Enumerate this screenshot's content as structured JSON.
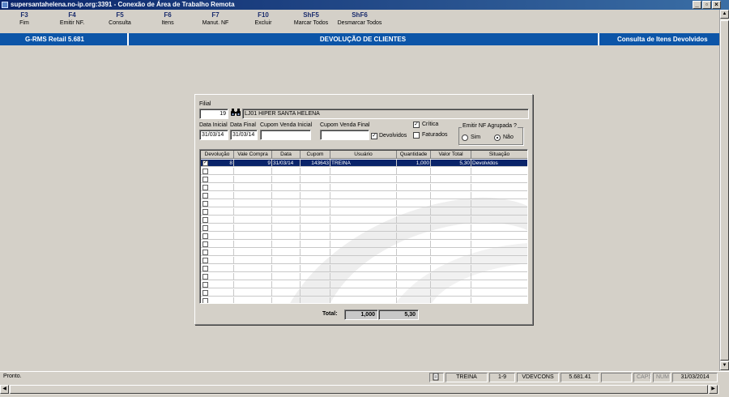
{
  "window": {
    "title": "supersantahelena.no-ip.org:3391 - Conexão de Área de Trabalho Remota",
    "min": "_",
    "restore": "▫",
    "close": "×"
  },
  "toolbar": [
    {
      "key": "F3",
      "label": "Fim"
    },
    {
      "key": "F4",
      "label": "Emitir NF."
    },
    {
      "key": "F5",
      "label": "Consulta"
    },
    {
      "key": "F6",
      "label": "Itens"
    },
    {
      "key": "F7",
      "label": "Manut. NF"
    },
    {
      "key": "F10",
      "label": "Excluir"
    },
    {
      "key": "ShF5",
      "label": "Marcar Todos"
    },
    {
      "key": "ShF6",
      "label": "Desmarcar Todos"
    }
  ],
  "header": {
    "app": "G-RMS Retail 5.681",
    "title": "DEVOLUÇÃO DE CLIENTES",
    "subtitle": "Consulta de Itens Devolvidos"
  },
  "form": {
    "filial_label": "Filial",
    "filial_code": "19",
    "filial_name": "LJ01 HIPER SANTA HELENA",
    "data_inicial_label": "Data Inicial",
    "data_inicial": "31/03/14",
    "data_final_label": "Data Final",
    "data_final": "31/03/14",
    "cupom_inicial_label": "Cupom Venda Inicial",
    "cupom_inicial": "",
    "cupom_final_label": "Cupom Venda Final",
    "cupom_final": "",
    "devolvidos_label": "Devolvidos",
    "devolvidos_checked": true,
    "critica_label": "Crítica",
    "critica_checked": true,
    "faturados_label": "Faturados",
    "faturados_checked": false,
    "agrupada_label": "Emitir NF Agrupada ?",
    "sim_label": "Sim",
    "nao_label": "Não",
    "agrupada_value": "Não",
    "check_mark": "✓"
  },
  "grid": {
    "columns": [
      "Devolução",
      "Vale Compra",
      "Data",
      "Cupom",
      "Usuário",
      "Quantidade",
      "Valor Total",
      "Situação"
    ],
    "rows": [
      {
        "checked": true,
        "devolucao": "8",
        "vale": "9",
        "data": "31/03/14",
        "cupom": "143643",
        "usuario": "TREINA",
        "quantidade": "1,000",
        "valor": "5,30",
        "situacao": "Devolvidos"
      }
    ],
    "empty_rows": 17
  },
  "totals": {
    "label": "Total:",
    "quantidade": "1,000",
    "valor": "5,30"
  },
  "statusbar": {
    "message": "Pronto.",
    "user": "TREINA",
    "position": "1-9",
    "program": "VDEVCONS",
    "version": "5.681.41",
    "caps": "CAPS",
    "num": "NUM",
    "date": "31/03/2014"
  },
  "icons": {
    "binoculars": "binoculars-icon",
    "document": "document-icon"
  }
}
